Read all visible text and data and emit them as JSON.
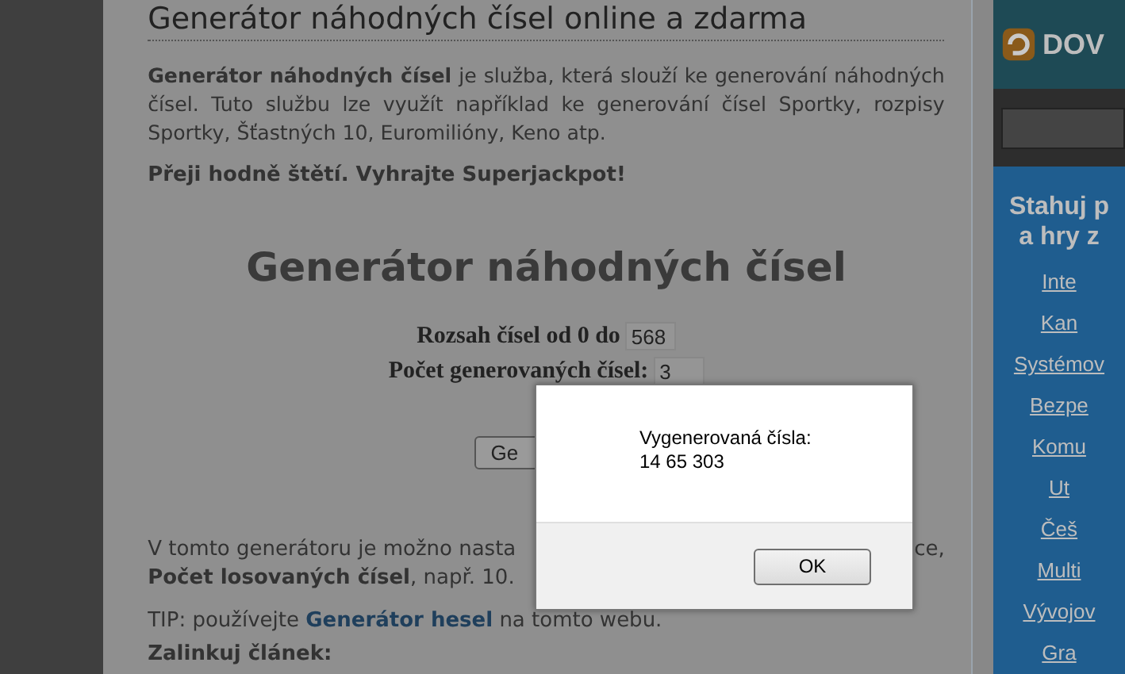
{
  "page": {
    "title": "Generátor náhodných čísel online a zdarma",
    "intro": "**Generátor náhodných čísel** je služba, která slouží ke generování náhodných čísel. Tuto službu lze využít například ke generování čísel Sportky, rozpisy Sportky, Šťastných 10, Euromilióny, Keno atp.",
    "wish": "Přeji hodně štětí. Vyhrajte Superjackpot!"
  },
  "generator": {
    "heading": "Generátor náhodných čísel",
    "fields": [
      {
        "label": "Rozsah čísel od 0 do",
        "value": "568"
      },
      {
        "label": "Počet generovaných čísel:",
        "value": "3"
      }
    ],
    "button": "Ge"
  },
  "info": {
    "line_start": "V tomto generátoru je možno nasta",
    "line_end": "ce,",
    "line_2": "**Počet losovaných čísel**, např. 10.",
    "tip_before": "TIP: používejte",
    "tip_link": "Generátor hesel",
    "tip_after": "na tomto webu.",
    "link_heading": "Zalinkuj článek:"
  },
  "ad": {
    "brand": "DOV",
    "headline": [
      "Stahuj p",
      "a hry z"
    ],
    "links": [
      "Inte",
      "Kan",
      "Systémov",
      "Bezpe",
      "Komu",
      "Ut",
      "Češ",
      "Multi",
      "Vývojov",
      "Gra"
    ]
  },
  "dialog": {
    "message": "Vygenerovaná čísla:",
    "numbers": "14 65 303",
    "ok": "OK"
  }
}
